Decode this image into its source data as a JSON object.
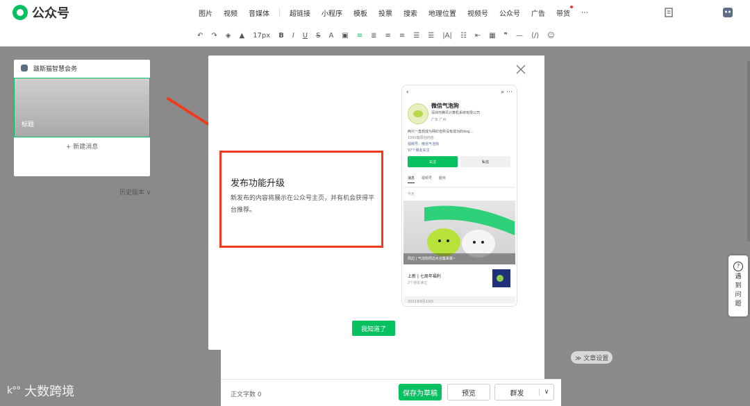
{
  "app": {
    "title": "公众号"
  },
  "menu": [
    "图片",
    "视频",
    "音媒体",
    "超链接",
    "小程序",
    "模板",
    "投票",
    "搜索",
    "地理位置",
    "视频号",
    "公众号",
    "广告",
    "带货",
    "⋯"
  ],
  "toolbar": {
    "font_size": "17px"
  },
  "sidebar": {
    "account_name": "跋斯猫智慧会务",
    "card_title": "标题",
    "new_message": "+ 新建消息",
    "history": "历史版本 ∨"
  },
  "footer": {
    "word_count": "正文字数  0",
    "save_draft": "保存为草稿",
    "preview": "预览",
    "publish": "群发",
    "article_settings": "≫ 文章设置"
  },
  "help": {
    "lines": [
      "遇",
      "到",
      "问",
      "题"
    ]
  },
  "watermark": {
    "text": "大数跨境",
    "mark": "k°°"
  },
  "modal": {
    "title": "发布功能升级",
    "description": "新发布的内容将展示在公众号主页，并有机会获得平台推荐。",
    "confirm": "我知道了",
    "phone": {
      "account_name": "微信气泡狗",
      "company": "深圳市腾讯计算机系统有限公司",
      "location": "广东 广州",
      "bio": "两只一直想成为网红但并没有成功的dog...",
      "content_count": "1060篇原创内容",
      "channel": "视频号：微信气泡狗",
      "friends": "97个朋友关注",
      "follow": "关注",
      "message": "私信",
      "tabs": [
        "消息",
        "视频号",
        "服务"
      ],
      "today": "今天",
      "image_caption": "周边 | 气泡狗周边大合集来袭~",
      "post_title": "上新 | 七周年福利",
      "post_sub": "2个朋友读过",
      "date": "2022年8月19日"
    }
  },
  "colors": {
    "brand_green": "#07c160",
    "highlight_red": "#f03a1f",
    "overlay": "#8a8a8a"
  }
}
